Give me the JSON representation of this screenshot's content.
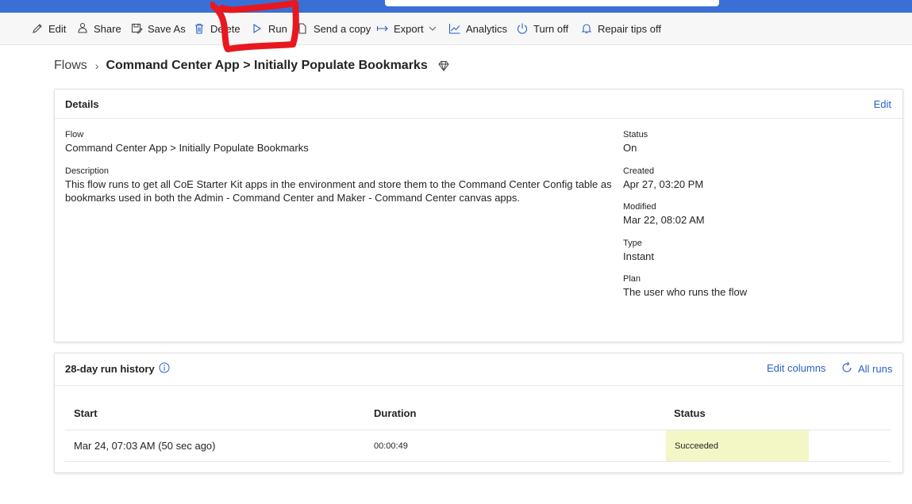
{
  "toolbar": {
    "edit": "Edit",
    "share": "Share",
    "save_as": "Save As",
    "delete": "Delete",
    "run": "Run",
    "send_copy": "Send a copy",
    "export": "Export",
    "analytics": "Analytics",
    "turn_off": "Turn off",
    "repair_tips": "Repair tips off"
  },
  "breadcrumb": {
    "root": "Flows",
    "current": "Command Center App > Initially Populate Bookmarks"
  },
  "details": {
    "title": "Details",
    "edit_link": "Edit",
    "flow_label": "Flow",
    "flow_value": "Command Center App > Initially Populate Bookmarks",
    "description_label": "Description",
    "description_line1": "This flow runs to get all CoE Starter Kit apps in the environment and store them to the Command Center Config table as",
    "description_line2": "bookmarks used in both the Admin - Command Center and Maker - Command Center canvas apps.",
    "status_label": "Status",
    "status_value": "On",
    "created_label": "Created",
    "created_value": "Apr 27, 03:20 PM",
    "modified_label": "Modified",
    "modified_value": "Mar 22, 08:02 AM",
    "type_label": "Type",
    "type_value": "Instant",
    "plan_label": "Plan",
    "plan_value": "The user who runs the flow"
  },
  "history": {
    "title": "28-day run history",
    "edit_columns": "Edit columns",
    "all_runs": "All runs",
    "columns": [
      "Start",
      "Duration",
      "Status"
    ],
    "rows": [
      {
        "start": "Mar 24, 07:03 AM (50 sec ago)",
        "duration": "00:00:49",
        "status": "Succeeded"
      }
    ]
  },
  "colors": {
    "accent": "#2862c6",
    "topbar": "#3a6fd6",
    "success_bg": "#f3f7c6",
    "annotation": "#e8181e"
  }
}
